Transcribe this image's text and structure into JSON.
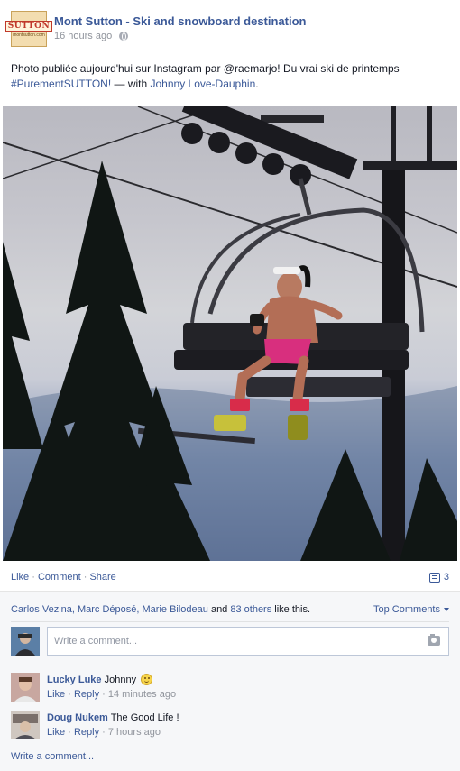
{
  "page": {
    "name": "Mont Sutton - Ski and snowboard destination",
    "timestamp": "16 hours ago",
    "avatar_logo": "SUTTON",
    "avatar_logo_sub": "montsutton.com"
  },
  "post": {
    "text_intro": "Photo publiée aujourd'hui sur Instagram par @raemarjo! Du vrai ski de printemps ",
    "hashtag": "#PurementSUTTON!",
    "with_text": " — with ",
    "with_name": "Johnny Love-Dauphin",
    "with_end": "."
  },
  "actions": {
    "like": "Like",
    "comment": "Comment",
    "share": "Share",
    "dot": " · ",
    "comment_count": "3"
  },
  "likes": {
    "names": "Carlos Vezina, Marc Déposé, Marie Bilodeau",
    "and": " and ",
    "others": "83 others",
    "like_this": " like this.",
    "sort_label": "Top Comments"
  },
  "composer": {
    "placeholder": "Write a comment..."
  },
  "comments": [
    {
      "author": "Lucky Luke",
      "text": "Johnny",
      "like": "Like",
      "reply": "Reply",
      "time": "14 minutes ago"
    },
    {
      "author": "Doug Nukem",
      "text": "The Good Life !",
      "like": "Like",
      "reply": "Reply",
      "time": "7 hours ago"
    }
  ],
  "footer": {
    "write_comment": "Write a comment..."
  },
  "icons": [
    "globe-icon",
    "comment-bubble-icon",
    "caret-down-icon",
    "camera-icon",
    "smile-icon"
  ],
  "colors": {
    "link": "#3b5998",
    "muted": "#90949c",
    "feedback_bg": "#f6f7f9"
  }
}
